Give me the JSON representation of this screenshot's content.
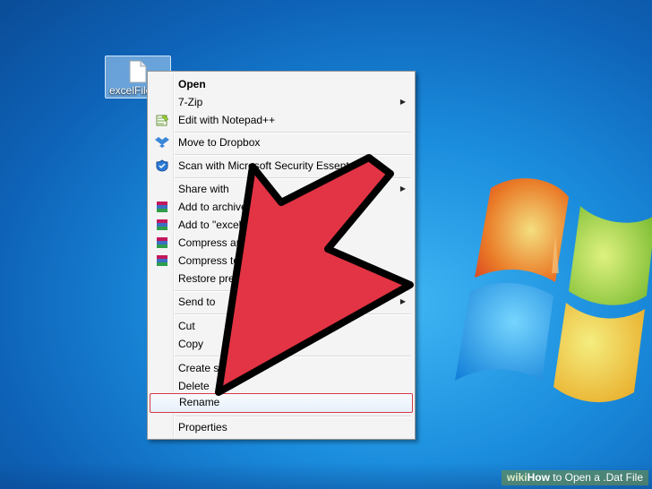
{
  "desktop": {
    "icon_label": "excelFile.",
    "brand_colors": {
      "logo_red": "#f25022",
      "logo_green": "#7fba00",
      "logo_blue": "#00a4ef",
      "logo_yellow": "#ffb900"
    }
  },
  "context_menu": {
    "items": [
      {
        "label": "Open",
        "bold": true,
        "icon": "",
        "submenu": false
      },
      {
        "label": "7-Zip",
        "icon": "",
        "submenu": true
      },
      {
        "label": "Edit with Notepad++",
        "icon": "notepad-plus-icon",
        "submenu": false
      },
      {
        "label": "Move to Dropbox",
        "icon": "dropbox-icon",
        "submenu": false
      },
      {
        "label": "Scan with Microsoft Security Essent",
        "icon": "security-essentials-icon",
        "submenu": false
      },
      {
        "label": "Share with",
        "icon": "",
        "submenu": true
      },
      {
        "label": "Add to archive",
        "icon": "winrar-icon",
        "submenu": false
      },
      {
        "label": "Add to \"excelF",
        "icon": "winrar-icon",
        "submenu": false
      },
      {
        "label": "Compress and",
        "icon": "winrar-icon",
        "submenu": false
      },
      {
        "label": "Compress to",
        "icon": "winrar-icon",
        "submenu": false
      },
      {
        "label": "Restore prev",
        "icon": "",
        "submenu": false
      },
      {
        "label": "Send to",
        "icon": "",
        "submenu": true
      },
      {
        "label": "Cut",
        "icon": "",
        "submenu": false
      },
      {
        "label": "Copy",
        "icon": "",
        "submenu": false
      },
      {
        "label": "Create sh",
        "icon": "",
        "submenu": false
      },
      {
        "label": "Delete",
        "icon": "",
        "submenu": false
      },
      {
        "label": "Rename",
        "icon": "",
        "submenu": false,
        "highlighted": true
      },
      {
        "label": "Properties",
        "icon": "",
        "submenu": false
      }
    ],
    "truncated_text_fragment": "il",
    "highlight_color": "#d43a45"
  },
  "annotation": {
    "arrow_color": "#e23444",
    "arrow_outline": "#000000",
    "points_to": "Rename"
  },
  "watermark": {
    "brand": "wiki",
    "how": "How",
    "rest": " to Open a .Dat File"
  }
}
